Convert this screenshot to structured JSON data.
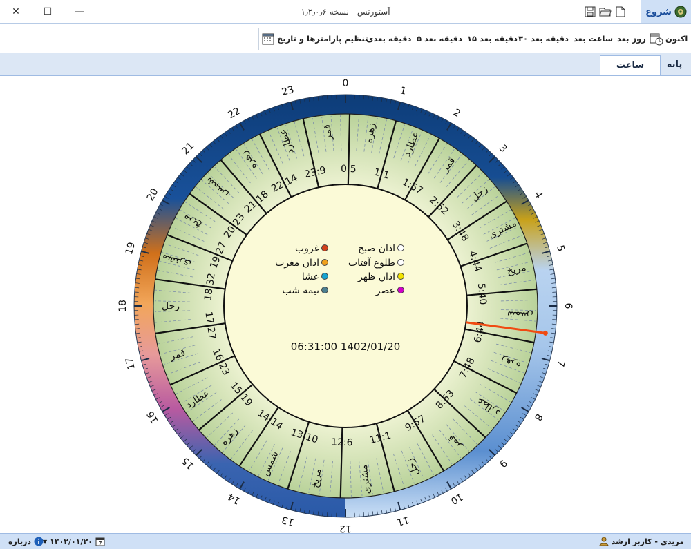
{
  "window": {
    "title": "آستورنس - نسخه ۱٫۲٫۰٫۶",
    "close": "✕",
    "maximize": "☐",
    "minimize": "—"
  },
  "ribbon_tab": {
    "label": "شروع"
  },
  "ribbon": {
    "now": "اکنون",
    "next_day": "روز بعد",
    "next_hour": "ساعت بعد",
    "next_30": "۳۰ دقیقه بعد",
    "next_15": "۱۵ دقیقه بعد",
    "next_5": "۵ دقیقه بعد",
    "next_1": "دقیقه بعدی",
    "settings": "تنظیم پارامترها و تاریخ",
    "collapse": "⌄"
  },
  "tabs": {
    "base": "پایه",
    "planetary_hours": "ساعت کواکب"
  },
  "clock": {
    "datetime": "06:31:00 1402/01/20",
    "hour_labels": [
      "0",
      "1",
      "2",
      "3",
      "4",
      "5",
      "6",
      "7",
      "8",
      "9",
      "10",
      "11",
      "12",
      "13",
      "14",
      "15",
      "16",
      "17",
      "18",
      "19",
      "20",
      "21",
      "22",
      "23"
    ],
    "ring_planets": [
      "زهره",
      "عطارد",
      "قمر",
      "زحل",
      "مشتری",
      "مریخ",
      "شمس",
      "زهره",
      "عطارد",
      "قمر",
      "زحل",
      "مشتری",
      "مریخ",
      "شمس",
      "زهره",
      "عطارد",
      "قمر",
      "زحل",
      "مشتری",
      "مریخ",
      "شمس",
      "زهره",
      "عطارد",
      "قمر"
    ],
    "ring_times": [
      "1:1",
      "1:57",
      "2:52",
      "3:48",
      "4:44",
      "5:40",
      "6:44",
      "7:48",
      "8:53",
      "9:57",
      "11:1",
      "12:6",
      "13:10",
      "14:14",
      "15:19",
      "16:23",
      "17:27",
      "18:32",
      "19:27",
      "20:23",
      "21:18",
      "22:14",
      "23:9",
      "0:5"
    ],
    "legend_right": [
      {
        "label": "اذان صبح",
        "color": "#ffffff"
      },
      {
        "label": "طلوع آفتاب",
        "color": "#ffffff"
      },
      {
        "label": "اذان ظهر",
        "color": "#f1e200"
      },
      {
        "label": "عصر",
        "color": "#d100c8"
      }
    ],
    "legend_left": [
      {
        "label": "غروب",
        "color": "#d2411a"
      },
      {
        "label": "اذان مغرب",
        "color": "#f0a11c"
      },
      {
        "label": "عشا",
        "color": "#17a3d0"
      },
      {
        "label": "نیمه شب",
        "color": "#4c7f8f"
      }
    ]
  },
  "status": {
    "user": "مریدی - کاربر ارشد",
    "date": "۱۴۰۲/۰۱/۲۰",
    "about": "درباره"
  },
  "colors": {
    "accent": "#1a4d9b",
    "night": "#0d3c78",
    "day_light": "#c7dcf3",
    "dial_fill": "#fbfad7",
    "band": "#cfe0b5",
    "hand": "#f04a12"
  }
}
